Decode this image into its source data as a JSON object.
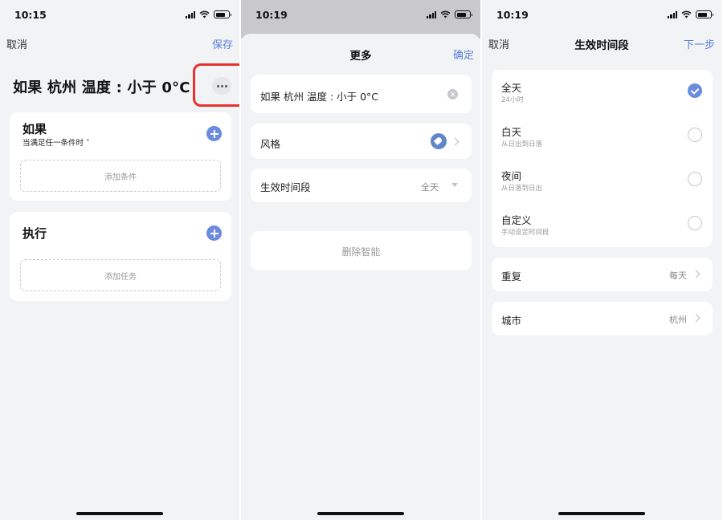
{
  "status": {
    "p1_time": "10:15",
    "p2_time": "10:19",
    "p3_time": "10:19"
  },
  "panel1": {
    "nav_left": "取消",
    "nav_right": "保存",
    "title": "如果 杭州 温度 : 小于 0°C",
    "if_card": {
      "title": "如果",
      "subtitle": "当满足任一条件时 ˅",
      "placeholder": "添加条件"
    },
    "do_card": {
      "title": "执行",
      "placeholder": "添加任务"
    }
  },
  "panel2": {
    "nav_title": "更多",
    "nav_right": "确定",
    "name_field": "如果 杭州 温度 : 小于 0°C",
    "style_label": "风格",
    "period_label": "生效时间段",
    "period_value": "全天",
    "delete_label": "删除智能"
  },
  "panel3": {
    "nav_left": "取消",
    "nav_title": "生效时间段",
    "nav_right": "下一步",
    "options": [
      {
        "title": "全天",
        "subtitle": "24小时",
        "checked": true
      },
      {
        "title": "白天",
        "subtitle": "从日出到日落",
        "checked": false
      },
      {
        "title": "夜间",
        "subtitle": "从日落到日出",
        "checked": false
      },
      {
        "title": "自定义",
        "subtitle": "手动设定时间段",
        "checked": false
      }
    ],
    "repeat_label": "重复",
    "repeat_value": "每天",
    "city_label": "城市",
    "city_value": "杭州"
  },
  "colors": {
    "accent": "#6b8be0",
    "highlight": "#e5322d",
    "background": "#f2f3f5"
  }
}
